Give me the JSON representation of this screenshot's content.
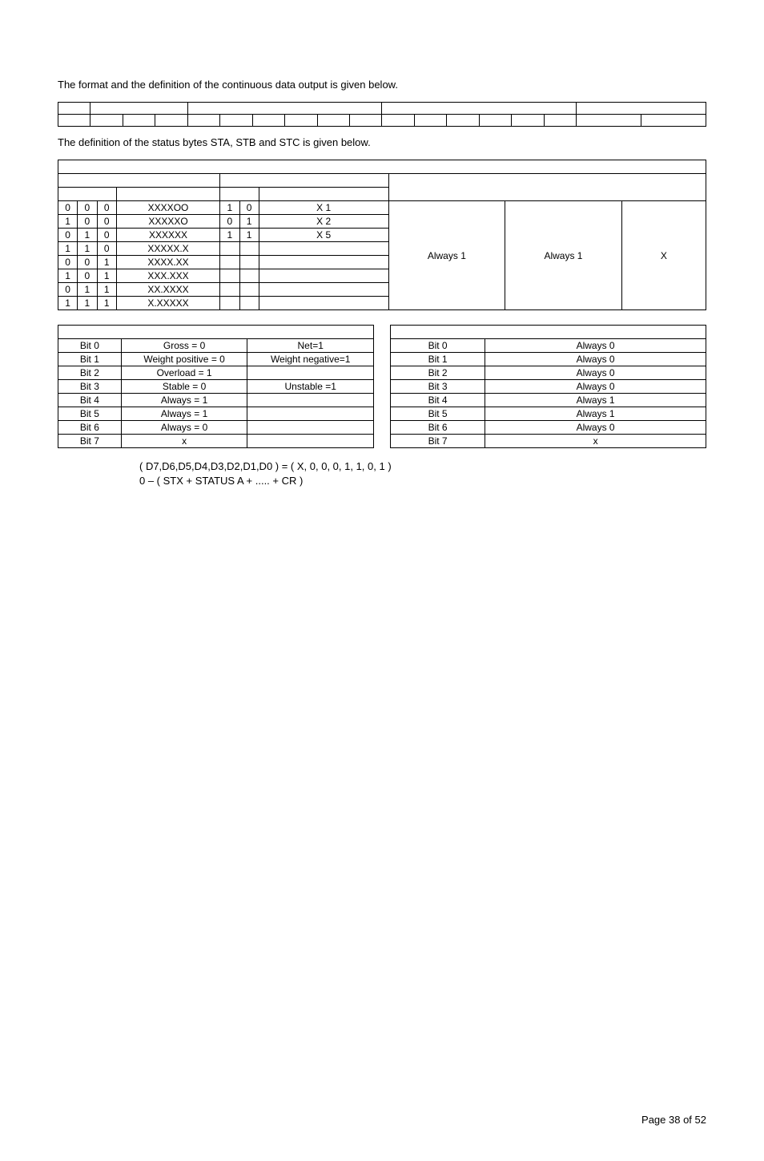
{
  "intro1": "The format and the definition of the continuous data output is given below.",
  "intro2": "The definition of the status bytes STA, STB and STC is given below.",
  "status_rows": [
    {
      "a": "0",
      "b": "0",
      "c": "0",
      "fmt": "XXXXOO",
      "d": "1",
      "e": "0",
      "x": "X 1"
    },
    {
      "a": "1",
      "b": "0",
      "c": "0",
      "fmt": "XXXXXO",
      "d": "0",
      "e": "1",
      "x": "X 2"
    },
    {
      "a": "0",
      "b": "1",
      "c": "0",
      "fmt": "XXXXXX",
      "d": "1",
      "e": "1",
      "x": "X 5"
    },
    {
      "a": "1",
      "b": "1",
      "c": "0",
      "fmt": "XXXXX.X",
      "d": "",
      "e": "",
      "x": ""
    },
    {
      "a": "0",
      "b": "0",
      "c": "1",
      "fmt": "XXXX.XX",
      "d": "",
      "e": "",
      "x": ""
    },
    {
      "a": "1",
      "b": "0",
      "c": "1",
      "fmt": "XXX.XXX",
      "d": "",
      "e": "",
      "x": ""
    },
    {
      "a": "0",
      "b": "1",
      "c": "1",
      "fmt": "XX.XXXX",
      "d": "",
      "e": "",
      "x": ""
    },
    {
      "a": "1",
      "b": "1",
      "c": "1",
      "fmt": "X.XXXXX",
      "d": "",
      "e": "",
      "x": ""
    }
  ],
  "status_right": {
    "c1": "Always 1",
    "c2": "Always 1",
    "c3": "X"
  },
  "bits_left": [
    {
      "bit": "Bit  0",
      "v1": "Gross = 0",
      "v2": "Net=1"
    },
    {
      "bit": "Bit  1",
      "v1": "Weight positive  = 0",
      "v2": "Weight negative=1"
    },
    {
      "bit": "Bit  2",
      "v1": "Overload = 1",
      "v2": ""
    },
    {
      "bit": "Bit  3",
      "v1": "Stable = 0",
      "v2": "Unstable =1"
    },
    {
      "bit": "Bit  4",
      "v1": "Always = 1",
      "v2": ""
    },
    {
      "bit": "Bit  5",
      "v1": "Always = 1",
      "v2": ""
    },
    {
      "bit": "Bit  6",
      "v1": "Always = 0",
      "v2": ""
    },
    {
      "bit": "Bit  7",
      "v1": "x",
      "v2": ""
    }
  ],
  "bits_right": [
    {
      "bit": "Bit  0",
      "v": "Always  0"
    },
    {
      "bit": "Bit  1",
      "v": "Always  0"
    },
    {
      "bit": "Bit  2",
      "v": "Always  0"
    },
    {
      "bit": "Bit  3",
      "v": "Always  0"
    },
    {
      "bit": "Bit  4",
      "v": "Always  1"
    },
    {
      "bit": "Bit  5",
      "v": "Always  1"
    },
    {
      "bit": "Bit  6",
      "v": "Always  0"
    },
    {
      "bit": "Bit  7",
      "v": "x"
    }
  ],
  "note1": "( D7,D6,D5,D4,D3,D2,D1,D0 )  =  (  X, 0, 0, 0, 1, 1, 0, 1 )",
  "note2": "0 – (  STX +  STATUS  A  +  ..... +  CR  )",
  "footer": "Page 38 of 52"
}
